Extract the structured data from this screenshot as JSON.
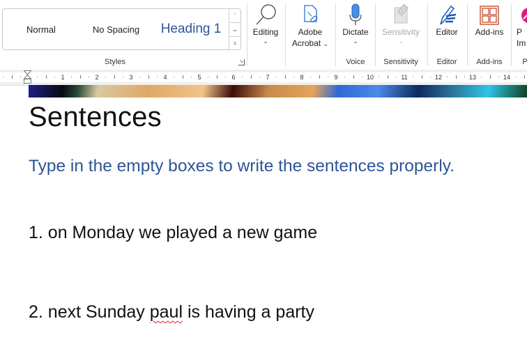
{
  "ribbon": {
    "styles_group": {
      "label": "Styles",
      "items": [
        {
          "label": "Normal"
        },
        {
          "label": "No Spacing"
        },
        {
          "label": "Heading 1"
        }
      ],
      "scroll_up": "⌃",
      "scroll_down": "⌄",
      "more": "⩡"
    },
    "buttons": [
      {
        "label": "Editing",
        "icon": "search-icon",
        "has_dropdown": true
      },
      {
        "label": "Adobe",
        "label2": "Acrobat",
        "icon": "adobe-acrobat-icon",
        "has_dropdown": true
      },
      {
        "label": "Dictate",
        "icon": "microphone-icon",
        "has_dropdown": true,
        "group": "Voice"
      },
      {
        "label": "Sensitivity",
        "icon": "sensitivity-icon",
        "has_dropdown": true,
        "disabled": true,
        "group": "Sensitivity"
      },
      {
        "label": "Editor",
        "icon": "editor-pen-icon",
        "group": "Editor"
      },
      {
        "label": "Add-ins",
        "icon": "add-ins-icon",
        "group": "Add-ins"
      },
      {
        "label": "P",
        "label2": "Im",
        "icon": "pink-app-icon",
        "group": "P"
      }
    ],
    "chevron": "⌄"
  },
  "ruler": {
    "numbers": [
      "1",
      "2",
      "3",
      "4",
      "5",
      "6",
      "7",
      "8",
      "9",
      "10",
      "11",
      "12",
      "13",
      "14"
    ]
  },
  "document": {
    "title": "Sentences",
    "subtitle": "Type in the empty boxes to write the sentences properly.",
    "items": [
      {
        "prefix": "1. on Monday we played a new game",
        "misspelled": "",
        "suffix": ""
      },
      {
        "prefix": "2. next Sunday ",
        "misspelled": "paul",
        "suffix": " is having a party"
      }
    ]
  },
  "colors": {
    "heading_blue": "#2e5597",
    "add_ins_orange": "#c43e1c",
    "editor_blue": "#185abd",
    "mic_blue": "#4a90e2",
    "spellcheck_red": "#e02020"
  }
}
